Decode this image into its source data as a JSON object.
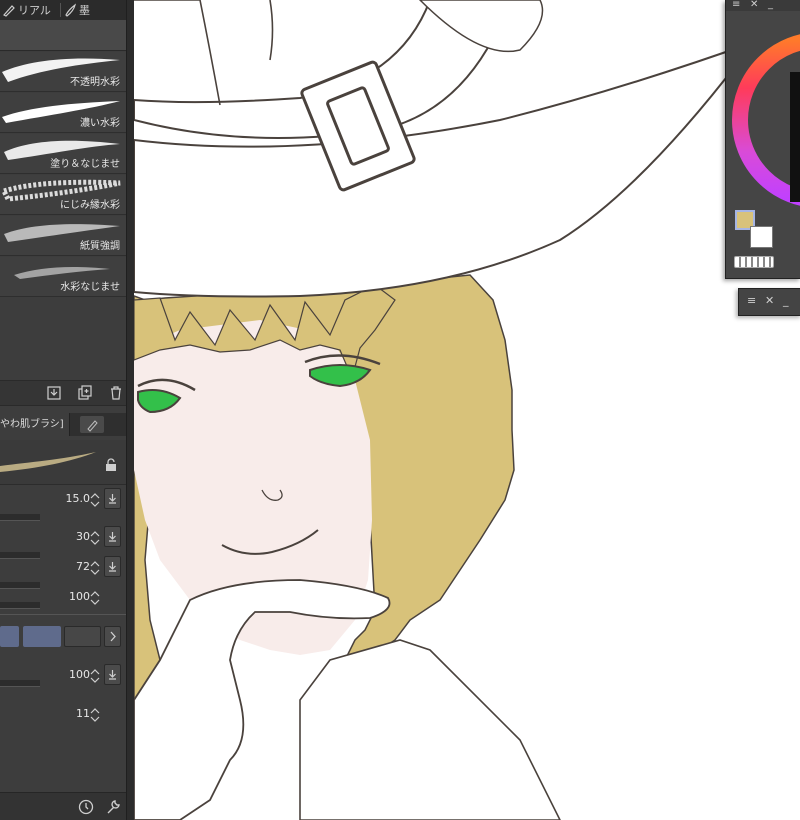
{
  "colors": {
    "panel_bg": "#3d3d3d",
    "accent_swatch_main": "#d8c27a",
    "accent_swatch_sub": "#ffffff",
    "hair": "#d8c27a",
    "eyes": "#33c04a",
    "line_art": "#4a423d"
  },
  "tool_tabs": [
    {
      "icon": "brush-icon",
      "label": "リアル"
    },
    {
      "icon": "ink-brush-icon",
      "label": "墨"
    }
  ],
  "brush_list": [
    {
      "name": "不透明水彩"
    },
    {
      "name": "濃い水彩"
    },
    {
      "name": "塗り＆なじませ"
    },
    {
      "name": "にじみ縁水彩"
    },
    {
      "name": "紙質強調"
    },
    {
      "name": "水彩なじませ"
    }
  ],
  "tool_property": {
    "tab_label": "やわ肌ブラシ]"
  },
  "settings": [
    {
      "value": "15.0"
    },
    {
      "value": "30"
    },
    {
      "value": "72"
    },
    {
      "value": "100"
    },
    {
      "value": "100"
    },
    {
      "value": "11"
    }
  ],
  "color_panel": {
    "main_color": "#d8c27a",
    "sub_color": "#ffffff"
  }
}
